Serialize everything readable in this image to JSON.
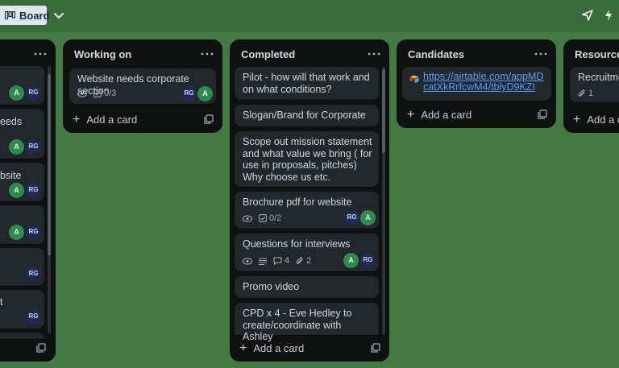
{
  "header": {
    "view_label": "Board"
  },
  "lists": {
    "left": {
      "cards": [
        {
          "text": ""
        },
        {
          "text": "eeds"
        },
        {
          "text": "bsite"
        },
        {
          "text": ""
        },
        {
          "text": ""
        },
        {
          "text": "t"
        }
      ]
    },
    "working_on": {
      "title": "Working on",
      "cards": [
        {
          "title": "Website needs corporate section",
          "checklist": "0/3"
        }
      ],
      "add_label": "Add a card"
    },
    "completed": {
      "title": "Completed",
      "cards": [
        {
          "title": "Pilot - how will that work and on what conditions?"
        },
        {
          "title": "Slogan/Brand for Corporate"
        },
        {
          "title": "Scope out mission statement and what value we bring ( for use in proposals, pitches) Why choose us etc."
        },
        {
          "title": "Brochure pdf for website",
          "checklist": "0/2"
        },
        {
          "title": "Questions for interviews",
          "comments": "4",
          "attachments": "2"
        },
        {
          "title": "Promo video"
        },
        {
          "title": "CPD x 4 - Eve Hedley to create/coordinate with Ashley"
        }
      ],
      "add_label": "Add a card"
    },
    "candidates": {
      "title": "Candidates",
      "cards": [
        {
          "link": "https://airtable.com/appMDcatXkRrfcwM4/tblyD9KZIa..."
        }
      ],
      "add_label": "Add a card"
    },
    "resources": {
      "title": "Resources",
      "cards": [
        {
          "title": "Recruitmen",
          "attachments": "1"
        }
      ],
      "add_label": "Add a ca"
    }
  },
  "avatars": {
    "a": "A",
    "rg": "RG"
  },
  "colors": {
    "board_bg": "#437a43",
    "list_bg": "#101204",
    "card_bg": "#22272b",
    "avatar_a": "#2f8a4e",
    "avatar_rg": "#1d2b55",
    "link": "#579dff"
  }
}
